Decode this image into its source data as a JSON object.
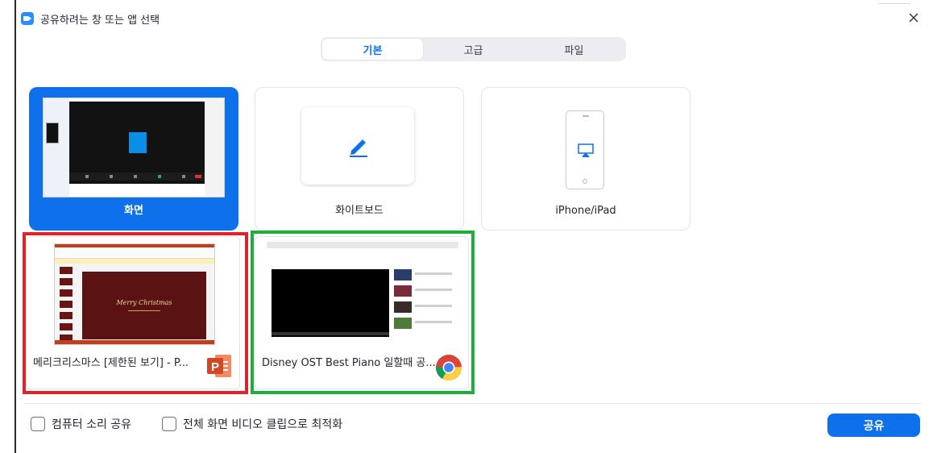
{
  "window": {
    "title": "공유하려는 창 또는 앱 선택",
    "app_icon": "zoom-camera-icon",
    "close_icon": "close-icon"
  },
  "tabs": [
    {
      "label": "기본",
      "active": true
    },
    {
      "label": "고급",
      "active": false
    },
    {
      "label": "파일",
      "active": false
    }
  ],
  "share_options": [
    {
      "label": "화면",
      "icon": "screen-thumbnail",
      "selected": true
    },
    {
      "label": "화이트보드",
      "icon": "pen-icon",
      "selected": false
    },
    {
      "label": "iPhone/iPad",
      "icon": "airplay-icon",
      "selected": false
    }
  ],
  "app_windows": [
    {
      "label": "메리크리스마스 [제한된 보기] - P...",
      "app_icon": "powerpoint-icon",
      "thumbnail_text": "Merry Christmas",
      "highlight_color": "#e4202b"
    },
    {
      "label": "Disney OST Best Piano 일할때 공...",
      "app_icon": "chrome-icon",
      "highlight_color": "#1fae3e"
    }
  ],
  "footer": {
    "option_sound": {
      "label": "컴퓨터 소리 공유",
      "checked": false
    },
    "option_video": {
      "label": "전체 화면 비디오 클립으로 최적화",
      "checked": false
    },
    "share_button": "공유"
  },
  "colors": {
    "accent": "#0e71eb",
    "tab_bg": "#ededf1",
    "powerpoint": "#d24726"
  }
}
